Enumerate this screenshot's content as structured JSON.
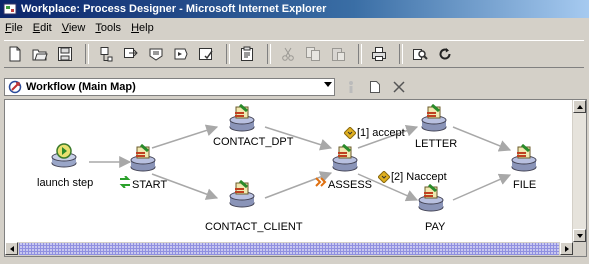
{
  "window": {
    "title": "Workplace: Process Designer - Microsoft Internet Explorer"
  },
  "menu": {
    "items": [
      {
        "label": "File",
        "mnemonic": "F",
        "rest": "ile"
      },
      {
        "label": "Edit",
        "mnemonic": "E",
        "rest": "dit"
      },
      {
        "label": "View",
        "mnemonic": "V",
        "rest": "iew"
      },
      {
        "label": "Tools",
        "mnemonic": "T",
        "rest": "ools"
      },
      {
        "label": "Help",
        "mnemonic": "H",
        "rest": "elp"
      }
    ]
  },
  "toolbar": {
    "buttons": [
      "new-icon",
      "open-icon",
      "save-icon",
      "step-icon",
      "route-icon",
      "submap-icon",
      "component-icon",
      "validate-icon",
      "properties-icon",
      "cut-icon",
      "copy-icon",
      "paste-icon",
      "print-icon",
      "zoom-icon",
      "refresh-icon"
    ]
  },
  "mapbar": {
    "selected_map": "Workflow (Main Map)"
  },
  "diagram": {
    "nodes": {
      "launch": "launch step",
      "start": "START",
      "contact_dpt": "CONTACT_DPT",
      "contact_client": "CONTACT_CLIENT",
      "assess": "ASSESS",
      "letter": "LETTER",
      "pay": "PAY",
      "file": "FILE"
    },
    "conditions": {
      "accept": "[1] accept",
      "naccept": "[2] Naccept"
    }
  },
  "colors": {
    "title_start": "#0a246a",
    "title_end": "#a6caf0",
    "chrome": "#d4d0c8",
    "edge": "#a8a8a8",
    "scroll_track": "#c8c8f0"
  }
}
